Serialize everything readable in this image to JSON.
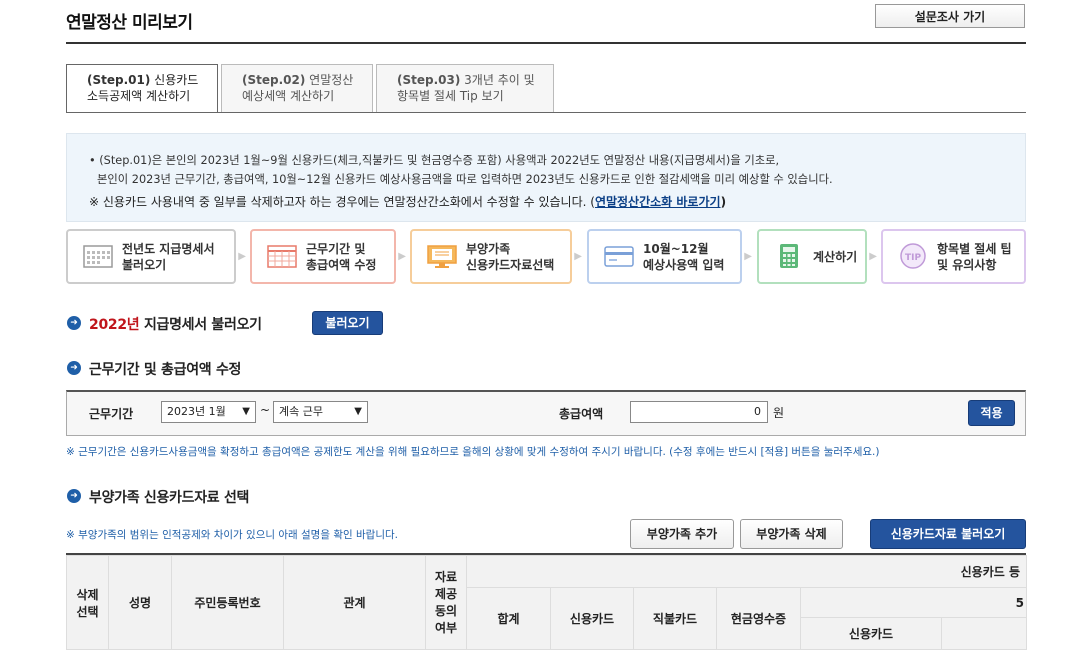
{
  "header": {
    "title": "연말정산 미리보기",
    "survey_button": "설문조사 가기"
  },
  "tabs": [
    {
      "step": "(Step.01)",
      "line1": "신용카드",
      "line2": "소득공제액 계산하기",
      "active": true
    },
    {
      "step": "(Step.02)",
      "line1": "연말정산",
      "line2": "예상세액 계산하기",
      "active": false
    },
    {
      "step": "(Step.03)",
      "line1": "3개년 추이 및",
      "line2": "항목별 절세 Tip 보기",
      "active": false
    }
  ],
  "notice": {
    "line1": "• (Step.01)은 본인의 2023년 1월~9월 신용카드(체크,직불카드 및 현금영수증 포함) 사용액과 2022년도 연말정산 내용(지급명세서)을 기초로,",
    "line2": "본인이 2023년 근무기간, 총급여액, 10월~12월 신용카드 예상사용금액을 따로 입력하면 2023년도 신용카드로 인한 절감세액을 미리 예상할 수 있습니다.",
    "line3_prefix": "※ 신용카드 사용내역 중 일부를 삭제하고자 하는 경우에는 연말정산간소화에서 수정할 수 있습니다. (",
    "line3_link": "연말정산간소화 바로가기",
    "line3_suffix": ")"
  },
  "steps": [
    {
      "line1": "전년도 지급명세서",
      "line2": "불러오기",
      "icon": "calendar-grid-icon",
      "color": "#9a9a9a"
    },
    {
      "line1": "근무기간 및",
      "line2": "총급여액 수정",
      "icon": "calendar-icon",
      "color": "#e87a6a"
    },
    {
      "line1": "부양가족",
      "line2": "신용카드자료선택",
      "icon": "monitor-icon",
      "color": "#f0a040"
    },
    {
      "line1": "10월~12월",
      "line2": "예상사용액 입력",
      "icon": "card-icon",
      "color": "#7aa0d8"
    },
    {
      "line1": "계산하기",
      "line2": "",
      "icon": "calculator-icon",
      "color": "#5cb878"
    },
    {
      "line1": "항목별 절세 팁",
      "line2": "및 유의사항",
      "icon": "tip-icon",
      "color": "#c09ad8"
    }
  ],
  "section1": {
    "year": "2022년",
    "title": "지급명세서 불러오기",
    "button": "불러오기"
  },
  "section2": {
    "title": "근무기간 및 총급여액 수정",
    "period_label": "근무기간",
    "period_start": "2023년 1월",
    "tilde": "~",
    "period_end": "계속 근무",
    "salary_label": "총급여액",
    "salary_value": "0",
    "unit": "원",
    "apply_button": "적용",
    "note": "※ 근무기간은 신용카드사용금액을 확정하고 총급여액은 공제한도 계산을 위해 필요하므로 올해의 상황에 맞게 수정하여 주시기 바랍니다. (수정 후에는 반드시 [적용] 버튼을 눌러주세요.)"
  },
  "section3": {
    "title": "부양가족 신용카드자료 선택",
    "note": "※ 부양가족의 범위는 인적공제와 차이가 있으니 아래 설명을 확인 바랍니다.",
    "add_button": "부양가족 추가",
    "delete_button": "부양가족 삭제",
    "load_button": "신용카드자료 불러오기"
  },
  "table": {
    "headers": [
      "삭제\n선택",
      "성명",
      "주민등록번호",
      "관계",
      "자료\n제공\n동의\n여부"
    ],
    "group_header": "신용카드 등",
    "sub_headers": [
      "합계",
      "신용카드",
      "직불카드",
      "현금영수증"
    ],
    "partial_header": "5",
    "sub2_header": "신용카드"
  }
}
